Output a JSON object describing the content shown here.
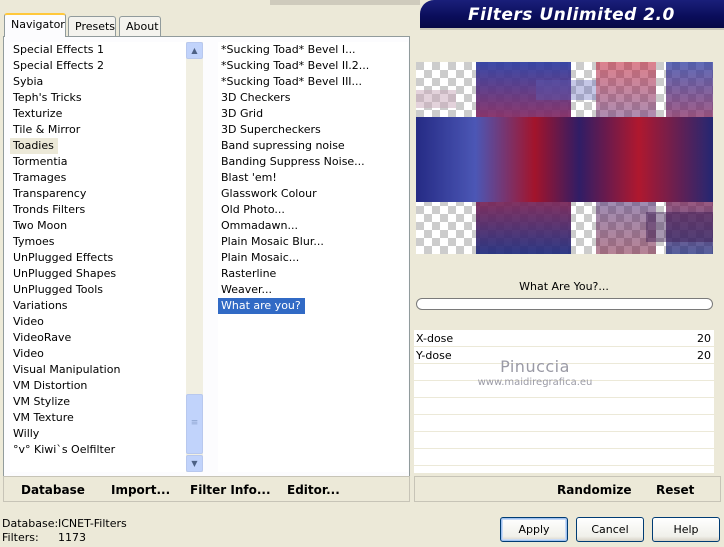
{
  "app": {
    "title": "Filters Unlimited 2.0"
  },
  "tabs": [
    {
      "label": "Navigator"
    },
    {
      "label": "Presets"
    },
    {
      "label": "About"
    }
  ],
  "categories": {
    "items": [
      "Special Effects 1",
      "Special Effects 2",
      "Sybia",
      "Teph's Tricks",
      "Texturize",
      "Tile & Mirror",
      "Toadies",
      "Tormentia",
      "Tramages",
      "Transparency",
      "Tronds Filters",
      "Two Moon",
      "Tymoes",
      "UnPlugged Effects",
      "UnPlugged Shapes",
      "UnPlugged Tools",
      "Variations",
      "Video",
      "VideoRave",
      "Video",
      "Visual Manipulation",
      "VM Distortion",
      "VM Stylize",
      "VM Texture",
      "Willy",
      "°v° Kiwi`s Oelfilter"
    ],
    "selected": "Toadies"
  },
  "filters": {
    "items": [
      "*Sucking Toad*  Bevel I...",
      "*Sucking Toad*  Bevel II.2...",
      "*Sucking Toad*  Bevel III...",
      "3D Checkers",
      "3D Grid",
      "3D Supercheckers",
      "Band supressing noise",
      "Banding Suppress Noise...",
      "Blast 'em!",
      "Glasswork Colour",
      "Old Photo...",
      "Ommadawn...",
      "Plain Mosaic Blur...",
      "Plain Mosaic...",
      "Rasterline",
      "Weaver...",
      "What are you?"
    ],
    "selected": "What are you?"
  },
  "links": {
    "database": "Database",
    "import": "Import...",
    "filter_info": "Filter Info...",
    "editor": "Editor...",
    "randomize": "Randomize",
    "reset": "Reset"
  },
  "preview": {
    "filter_name": "What Are You?..."
  },
  "params": [
    {
      "label": "X-dose",
      "value": "20"
    },
    {
      "label": "Y-dose",
      "value": "20"
    }
  ],
  "watermark": {
    "name": "Pinuccia",
    "url": "www.maidiregrafica.eu"
  },
  "footer": {
    "database_label": "Database:",
    "database_value": "ICNET-Filters",
    "filters_label": "Filters:",
    "filters_value": "1173"
  },
  "buttons": {
    "apply": "Apply",
    "cancel": "Cancel",
    "help": "Help"
  },
  "colors": {
    "banner": "#0a0d5a",
    "selection": "#316ac5",
    "window": "#ece9d8"
  }
}
